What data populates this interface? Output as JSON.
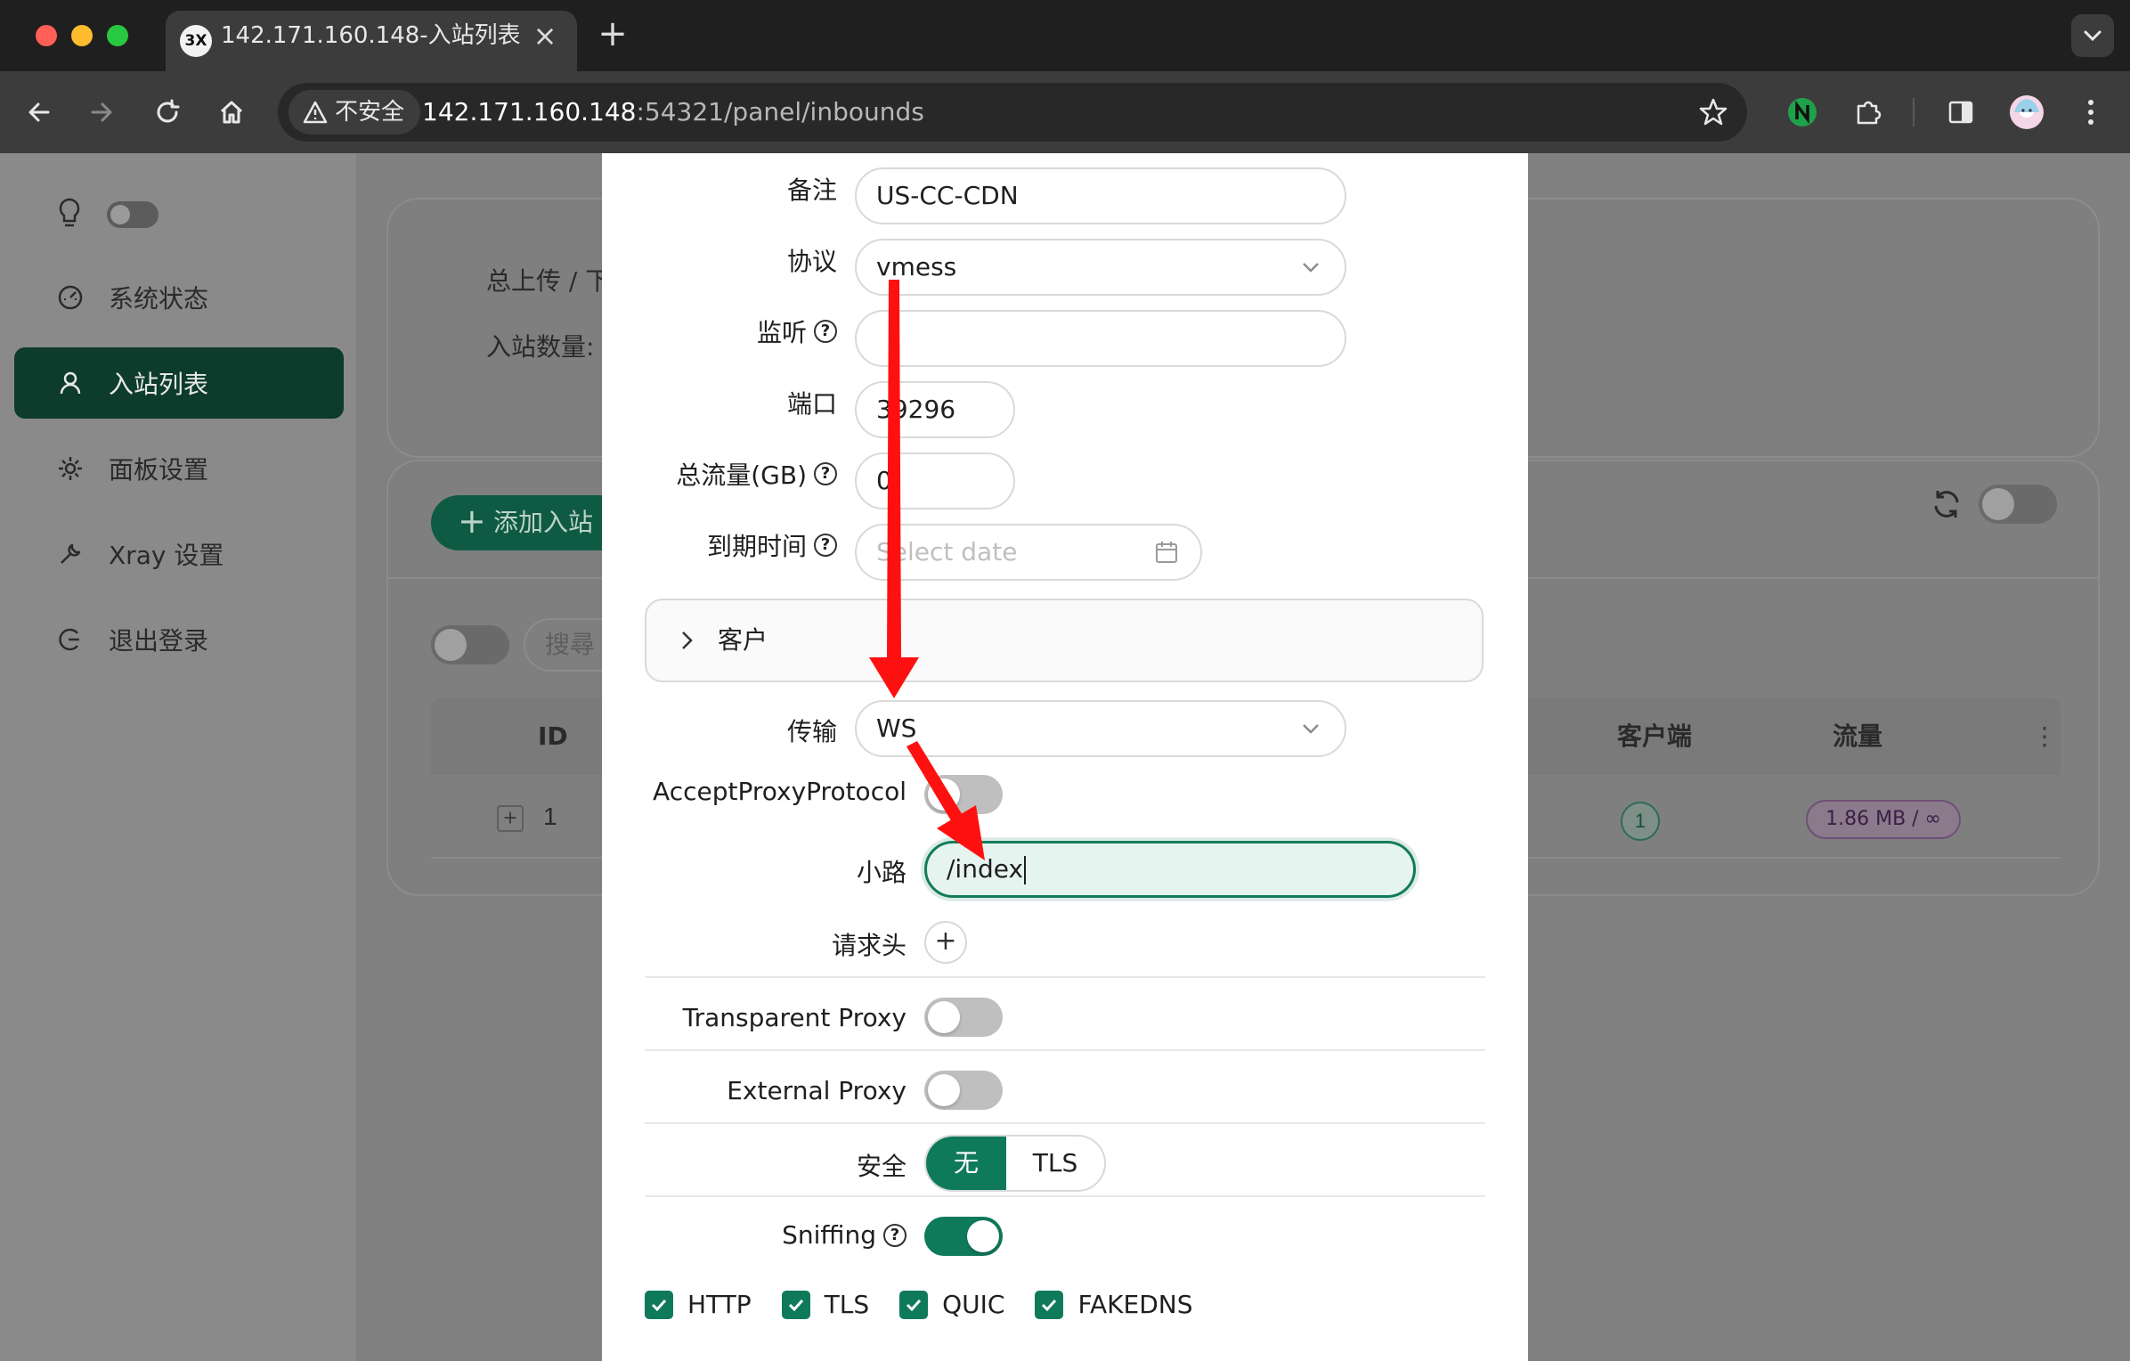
{
  "browser": {
    "tab_favicon": "3X",
    "tab_title": "142.171.160.148-入站列表",
    "tab_close": "×",
    "new_tab": "+",
    "security_label": "不安全",
    "url_host": "142.171.160.148",
    "url_rest": ":54321/panel/inbounds"
  },
  "sidebar": {
    "items": [
      {
        "label": "系统状态",
        "icon": "dashboard-icon"
      },
      {
        "label": "入站列表",
        "icon": "user-icon"
      },
      {
        "label": "面板设置",
        "icon": "gear-icon"
      },
      {
        "label": "Xray 设置",
        "icon": "wrench-icon"
      },
      {
        "label": "退出登录",
        "icon": "logout-icon"
      }
    ]
  },
  "background": {
    "stat_upload": "总上传 / 下",
    "stat_count": "入站数量: ",
    "add_button": "添加入站",
    "search_placeholder": "搜尋",
    "table_headers": {
      "id": "ID",
      "clients": "客户端",
      "traffic": "流量"
    },
    "row": {
      "expand": "+",
      "id": "1",
      "clients": "1",
      "traffic": "1.86 MB / ∞"
    }
  },
  "form": {
    "remark": {
      "label": "备注",
      "value": "US-CC-CDN"
    },
    "protocol": {
      "label": "协议",
      "value": "vmess"
    },
    "listen": {
      "label": "监听",
      "value": ""
    },
    "port": {
      "label": "端口",
      "value": "39296"
    },
    "total_traffic": {
      "label": "总流量(GB)",
      "value": "0"
    },
    "expiry": {
      "label": "到期时间",
      "placeholder": "Select date"
    },
    "clients_panel": {
      "label": "客户"
    },
    "transport": {
      "label": "传输",
      "value": "WS"
    },
    "accept_proxy_protocol": {
      "label": "AcceptProxyProtocol",
      "on": false
    },
    "path": {
      "label": "小路",
      "value": "/index"
    },
    "request_header": {
      "label": "请求头",
      "add": "+"
    },
    "transparent_proxy": {
      "label": "Transparent Proxy",
      "on": false
    },
    "external_proxy": {
      "label": "External Proxy",
      "on": false
    },
    "security": {
      "label": "安全",
      "options": [
        "无",
        "TLS"
      ],
      "selected": "无"
    },
    "sniffing": {
      "label": "Sniffing",
      "on": true
    },
    "sniff_protocols": [
      "HTTP",
      "TLS",
      "QUIC",
      "FAKEDNS"
    ]
  },
  "colors": {
    "accent": "#0f7a5a",
    "sidebar_active": "#0d3b2c",
    "annotation": "#ff0000"
  }
}
